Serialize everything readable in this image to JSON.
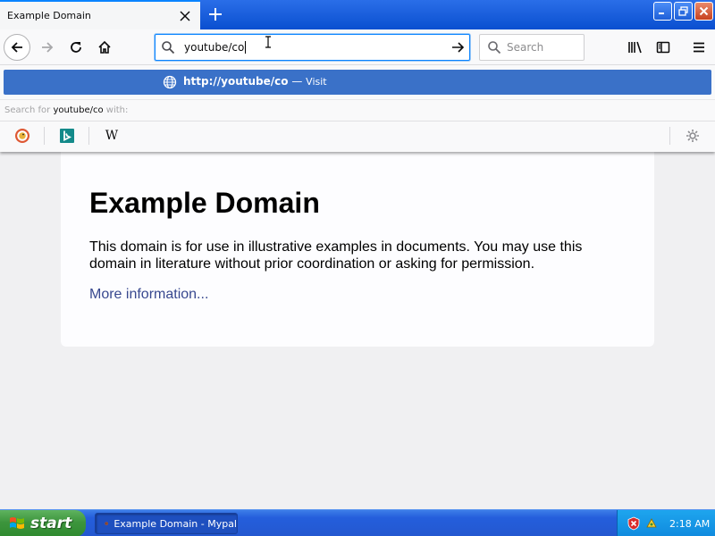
{
  "tab": {
    "title": "Example Domain"
  },
  "urlbar": {
    "value": "youtube/co"
  },
  "searchbar": {
    "placeholder": "Search"
  },
  "dropdown": {
    "suggestion_url": "http://youtube/co",
    "suggestion_separator": " — ",
    "suggestion_action": "Visit",
    "search_for_prefix": "Search for ",
    "search_for_term": "youtube/co",
    "search_for_suffix": " with:",
    "engines": [
      "duckduckgo",
      "bing",
      "wikipedia"
    ],
    "wikipedia_letter": "W"
  },
  "page": {
    "title": "Example Domain",
    "paragraph": "This domain is for use in illustrative examples in documents. You may use this domain in literature without prior coordination or asking for permission.",
    "link": "More information..."
  },
  "taskbar": {
    "start_label": "start",
    "task_label": "Example Domain - Mypal",
    "clock": "2:18 AM"
  },
  "colors": {
    "accent": "#0a84ff",
    "suggestion_bg": "#3a71c8",
    "link": "#38488f",
    "taskbar": "#245edc",
    "start": "#3d953d"
  }
}
